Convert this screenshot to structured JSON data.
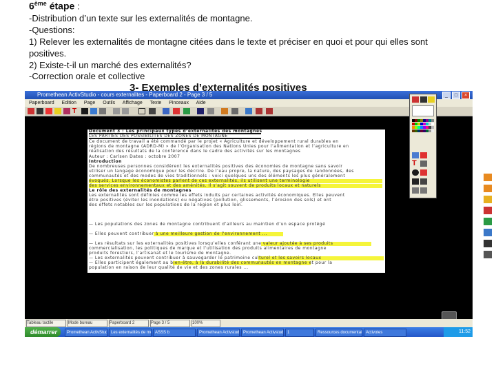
{
  "slide": {
    "step_number": "6",
    "step_sup": "ème",
    "step_word": "étape",
    "step_colon": ":",
    "lines": [
      "-Distribution d’un texte sur les externalités de montagne.",
      "-Questions:",
      "1) Relever les externalités de montagne citées dans le texte et préciser en quoi et pour qui elles sont",
      "positives.",
      "2) Existe-t-il un marché des externalités?",
      "-Correction orale et collective"
    ],
    "section_title": "3- Exemples d’externalités positives"
  },
  "app": {
    "title": "Promethean ActivStudio - cours externalites - Paperboard 2 - Page 3 / 5",
    "menu": [
      "Paperboard",
      "Edition",
      "Page",
      "Outils",
      "Affichage",
      "Texte",
      "Pinceaux",
      "Aide"
    ],
    "document_lines": [
      {
        "text": "Document 3 : Les principaux types d’externalités des montagnes",
        "bold": true
      },
      {
        "text": "LES PARTIES DES POSSIBILITÉS DES ZONES DE MONTAGNE",
        "bold": false
      },
      {
        "text": "Ce document de travail a été commandé par le projet « Agriculture et développement rural durables en",
        "bold": false
      },
      {
        "text": "régions de montagne (ADRD-M) » de l’Organisation des Nations Unies pour l’alimentation et l’agriculture en",
        "bold": false
      },
      {
        "text": "réalisation des résultats de la conférence dans le cadre des activités sur les montagnes",
        "bold": false
      },
      {
        "text": "Auteur : Carlsen  Dates : octobre 2007",
        "bold": false
      },
      {
        "text": "Introduction",
        "bold": true
      },
      {
        "text": "De nombreuses personnes considèrent les externalités positives des économies de montagne sans savoir",
        "bold": false
      },
      {
        "text": "utiliser un langage économique pour les décrire. De l’eau propre, la nature, des paysages de randonnées, des",
        "bold": false
      },
      {
        "text": "communautés et des modes de vies traditionnels : voici quelques uns des éléments les plus généralement",
        "bold": false
      },
      {
        "text": "évoqués. Lorsque les économistes parlent de ces externalités, ils utilisent une terminologie",
        "bold": false
      },
      {
        "text": "des services environnementaux et des aménités. Il s’agit souvent de produits locaux et naturels",
        "bold": false
      },
      {
        "text": "Le rôle des externalités de montagnes",
        "bold": true
      },
      {
        "text": "Les externalités sont définies comme les effets induits par certaines activités économiques. Elles peuvent",
        "bold": false
      },
      {
        "text": "être positives (éviter les inondations) ou négatives (pollution, glissements, l’érosion des sols) et ont",
        "bold": false
      },
      {
        "text": "des effets notables sur les populations de la région et plus loin.",
        "bold": false
      },
      {
        "text": "— Les populations des zones de montagne contribuent d’ailleurs au maintien d’un espace protégé",
        "bold": false
      },
      {
        "text": "— Elles peuvent contribuer à une meilleure gestion de l’environnement ...",
        "bold": false
      },
      {
        "text": "— Les résultats sur les externalités positives lorsqu’elles conférant une valeur ajoutée à ses produits",
        "bold": false
      },
      {
        "text": "commercialisation, les politiques de marque et l’utilisation des produits alimentaires de montagne",
        "bold": false
      },
      {
        "text": "produits forestiers, l’artisanat et le tourisme de montagne.",
        "bold": false
      },
      {
        "text": "— Les externalités peuvent contribuer à sauvegarder le patrimoine culturel et les savoirs locaux",
        "bold": false
      },
      {
        "text": "— Elles participent également au bien-être, à la durabilité des communautés en montagne et pour la",
        "bold": false
      },
      {
        "text": "population en raison de leur qualité de vie et des zones rurales ...",
        "bold": false
      }
    ],
    "status_cells": [
      "Tableau tactile",
      "Mode bureau",
      "Paperboard 2",
      "Page 3 / 5",
      "100%"
    ],
    "taskbar": {
      "start_label": "démarrer",
      "tasks": [
        "Promethean ActivStudio",
        "Les externalités de mon...",
        "ASSS b",
        "Promethean Activstudio...",
        "Promethean Activstudio",
        "1",
        "Ressources documentaires...",
        "Activotes"
      ],
      "clock": "11:52"
    },
    "colors": {
      "highlight": "#f5f53a",
      "titlebar": "#2d5fc4",
      "taskbar": "#2d6ad6",
      "start_green": "#3c9a38"
    }
  }
}
